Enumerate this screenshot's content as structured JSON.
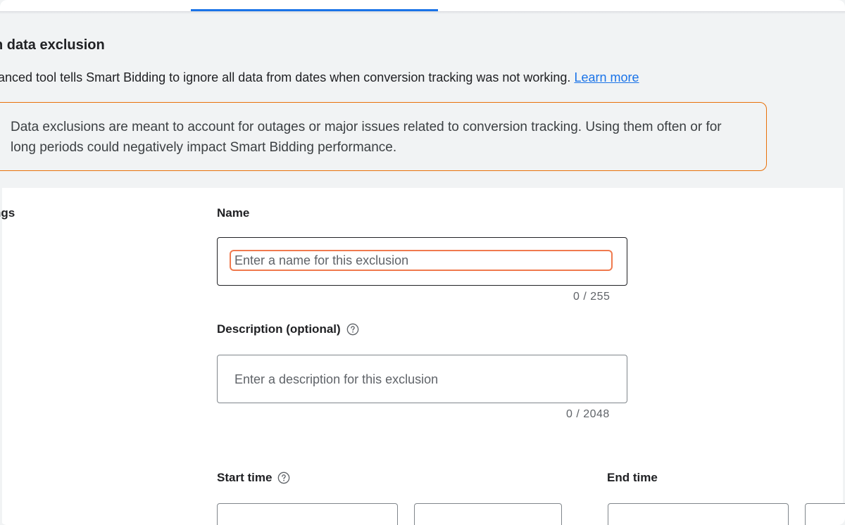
{
  "header": {
    "title": "n data exclusion",
    "description": "anced tool tells Smart Bidding to ignore all data from dates when conversion tracking was not working.",
    "learn_more_label": "Learn more"
  },
  "warning": {
    "text": "Data exclusions are meant to account for outages or major issues related to conversion tracking. Using them often or for long periods could negatively impact Smart Bidding performance."
  },
  "form": {
    "section_label": "ngs",
    "name": {
      "label": "Name",
      "placeholder": "Enter a name for this exclusion",
      "value": "",
      "counter": "0 / 255"
    },
    "description": {
      "label": "Description (optional)",
      "placeholder": "Enter a description for this exclusion",
      "value": "",
      "counter": "0 / 2048"
    },
    "start_time": {
      "label": "Start time"
    },
    "end_time": {
      "label": "End time"
    }
  },
  "colors": {
    "accent": "#1a73e8",
    "warning_border": "#e8710a",
    "focus_ring": "#f07a4e"
  },
  "icons": {
    "description_help": "help-circle-icon",
    "start_time_help": "help-circle-icon"
  }
}
